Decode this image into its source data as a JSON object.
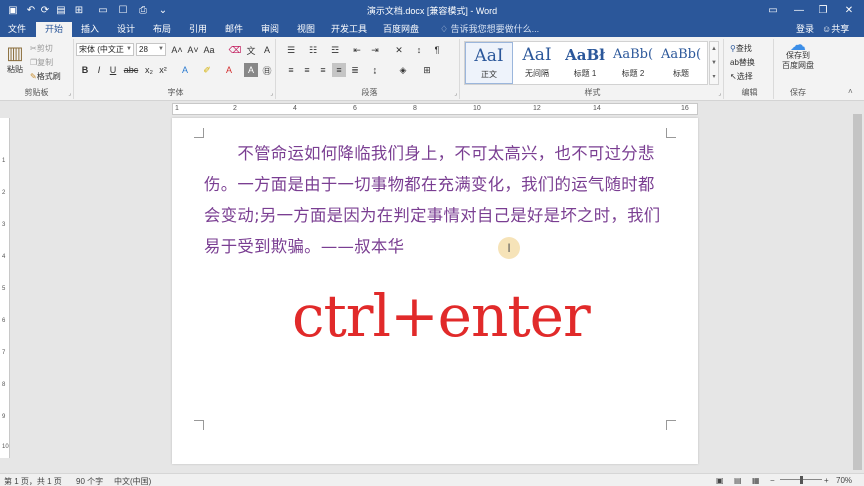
{
  "titlebar": {
    "title": "演示文档.docx [兼容模式] - Word",
    "minimize": "—",
    "restore": "❐",
    "close": "✕"
  },
  "tabs": [
    {
      "label": "文件"
    },
    {
      "label": "开始"
    },
    {
      "label": "插入"
    },
    {
      "label": "设计"
    },
    {
      "label": "布局"
    },
    {
      "label": "引用"
    },
    {
      "label": "邮件"
    },
    {
      "label": "审阅"
    },
    {
      "label": "视图"
    },
    {
      "label": "开发工具"
    },
    {
      "label": "百度网盘"
    }
  ],
  "tell_me": "告诉我您想要做什么...",
  "account": {
    "login": "登录",
    "share": "共享"
  },
  "clipboard": {
    "paste": "粘贴",
    "cut": "剪切",
    "copy": "复制",
    "format_painter": "格式刷",
    "label": "剪贴板"
  },
  "font": {
    "name": "宋体 (中文正",
    "size": "28",
    "label": "字体"
  },
  "paragraph": {
    "label": "段落"
  },
  "styles": {
    "items": [
      {
        "preview": "AaI",
        "name": "正文"
      },
      {
        "preview": "AaI",
        "name": "无间隔"
      },
      {
        "preview": "AaBł",
        "name": "标题 1"
      },
      {
        "preview": "AaBb(",
        "name": "标题 2"
      },
      {
        "preview": "AaBb(",
        "name": "标题"
      }
    ],
    "label": "样式"
  },
  "editing": {
    "find": "查找",
    "replace": "替换",
    "select": "选择",
    "label": "编辑"
  },
  "save": {
    "save_to": "保存到",
    "baidu": "百度网盘",
    "label": "保存"
  },
  "ruler": {
    "h_numbers": [
      "1",
      "2",
      "4",
      "6",
      "8",
      "10",
      "12",
      "14",
      "16"
    ],
    "v_numbers": [
      "1",
      "2",
      "3",
      "4",
      "5",
      "6",
      "7",
      "8",
      "9",
      "10"
    ]
  },
  "document": {
    "paragraph": "　　不管命运如何降临我们身上，不可太高兴，也不可过分悲伤。一方面是由于一切事物都在充满变化，我们的运气随时都会变动;另一方面是因为在判定事情对自己是好是坏之时，我们易于受到欺骗。——叔本华",
    "big_text": "ctrl+enter",
    "text_color": "#7a3e92",
    "big_text_color": "#e12a2a"
  },
  "status": {
    "page": "第 1 页，共 1 页",
    "words": "90 个字",
    "language": "中文(中国)",
    "zoom": "70%"
  },
  "colors": {
    "accent": "#2b579a"
  }
}
